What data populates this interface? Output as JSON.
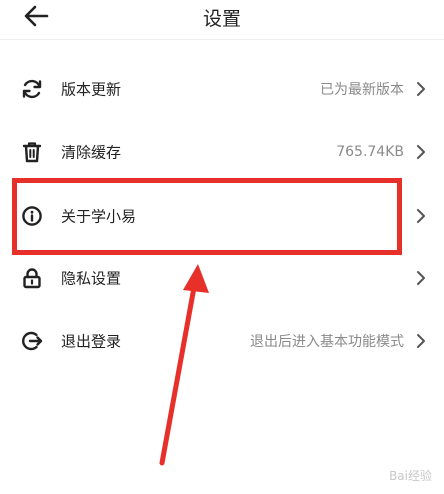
{
  "header": {
    "title": "设置"
  },
  "settings": {
    "items": [
      {
        "label": "版本更新",
        "value": "已为最新版本",
        "icon": "refresh-icon"
      },
      {
        "label": "清除缓存",
        "value": "765.74KB",
        "icon": "trash-icon"
      },
      {
        "label": "关于学小易",
        "value": "",
        "icon": "info-icon"
      },
      {
        "label": "隐私设置",
        "value": "",
        "icon": "lock-icon"
      },
      {
        "label": "退出登录",
        "value": "退出后进入基本功能模式",
        "icon": "logout-icon"
      }
    ]
  },
  "annotation": {
    "highlighted_item": "关于学小易",
    "highlight_color": "#e8302a"
  },
  "watermark": {
    "text": "Bai经验"
  },
  "colors": {
    "text": "#222222",
    "secondary_text": "#8a8a8a",
    "chevron": "#555555",
    "annotation": "#e8302a"
  }
}
